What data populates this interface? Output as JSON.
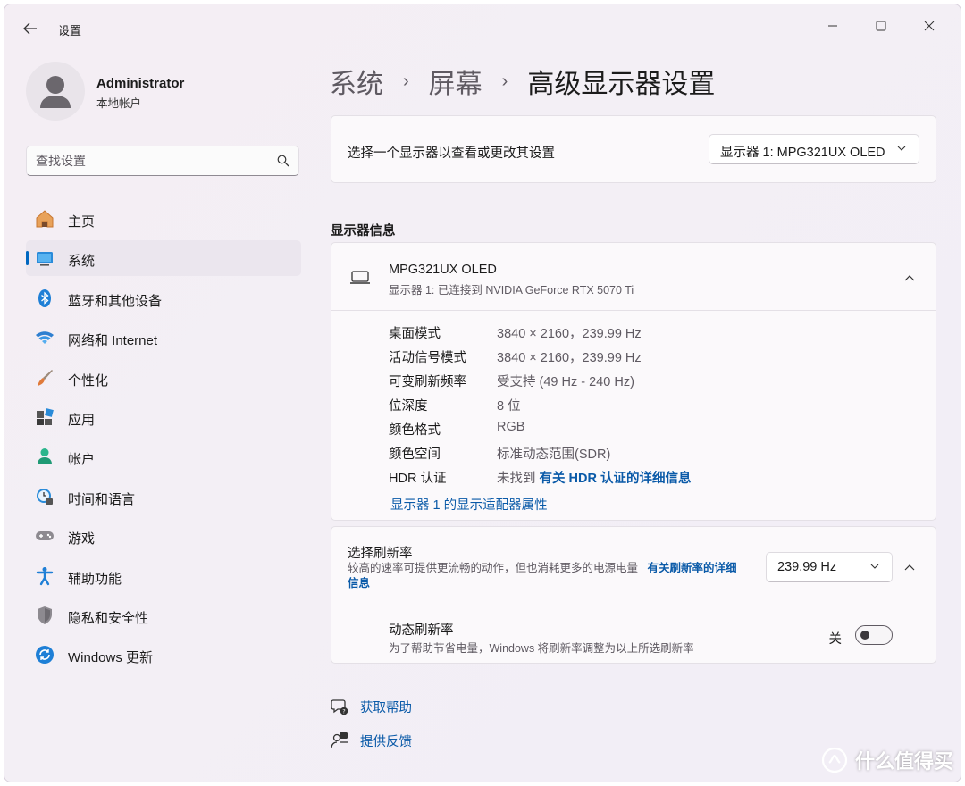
{
  "titlebar": {
    "title": "设置"
  },
  "user": {
    "name": "Administrator",
    "account_type": "本地帐户"
  },
  "search": {
    "placeholder": "查找设置"
  },
  "sidebar": {
    "items": [
      {
        "label": "主页",
        "icon": "home-icon"
      },
      {
        "label": "系统",
        "icon": "system-icon",
        "active": true
      },
      {
        "label": "蓝牙和其他设备",
        "icon": "bluetooth-icon"
      },
      {
        "label": "网络和 Internet",
        "icon": "wifi-icon"
      },
      {
        "label": "个性化",
        "icon": "brush-icon"
      },
      {
        "label": "应用",
        "icon": "apps-icon"
      },
      {
        "label": "帐户",
        "icon": "account-icon"
      },
      {
        "label": "时间和语言",
        "icon": "time-language-icon"
      },
      {
        "label": "游戏",
        "icon": "gamepad-icon"
      },
      {
        "label": "辅助功能",
        "icon": "accessibility-icon"
      },
      {
        "label": "隐私和安全性",
        "icon": "shield-icon"
      },
      {
        "label": "Windows 更新",
        "icon": "update-icon"
      }
    ]
  },
  "breadcrumb": {
    "level1": "系统",
    "level2": "屏幕",
    "current": "高级显示器设置",
    "separator": "›"
  },
  "select_display": {
    "label": "选择一个显示器以查看或更改其设置",
    "value": "显示器 1: MPG321UX OLED"
  },
  "display_info": {
    "section_title": "显示器信息",
    "monitor_name": "MPG321UX OLED",
    "monitor_sub": "显示器 1: 已连接到 NVIDIA GeForce RTX 5070 Ti",
    "rows": [
      {
        "key": "桌面模式",
        "value": "3840 × 2160，239.99 Hz"
      },
      {
        "key": "活动信号模式",
        "value": "3840 × 2160，239.99 Hz"
      },
      {
        "key": "可变刷新频率",
        "value": "受支持 (49 Hz - 240 Hz)"
      },
      {
        "key": "位深度",
        "value": "8 位"
      },
      {
        "key": "颜色格式",
        "value": "RGB"
      },
      {
        "key": "颜色空间",
        "value": "标准动态范围(SDR)"
      },
      {
        "key": "HDR 认证",
        "value": "未找到",
        "link": "有关 HDR 认证的详细信息"
      }
    ],
    "adapter_link": "显示器 1 的显示适配器属性"
  },
  "refresh_rate": {
    "title": "选择刷新率",
    "description": "较高的速率可提供更流畅的动作，但也消耗更多的电源电量",
    "link": "有关刷新率的详细信息",
    "value": "239.99 Hz"
  },
  "dynamic_refresh": {
    "title": "动态刷新率",
    "description": "为了帮助节省电量，Windows 将刷新率调整为以上所选刷新率",
    "state_label": "关"
  },
  "help": {
    "get_help": "获取帮助",
    "feedback": "提供反馈"
  },
  "watermark": {
    "text": "什么值得买"
  },
  "colors": {
    "accent": "#0067c0",
    "link": "#0a5aa8",
    "background": "#f3eff5"
  }
}
